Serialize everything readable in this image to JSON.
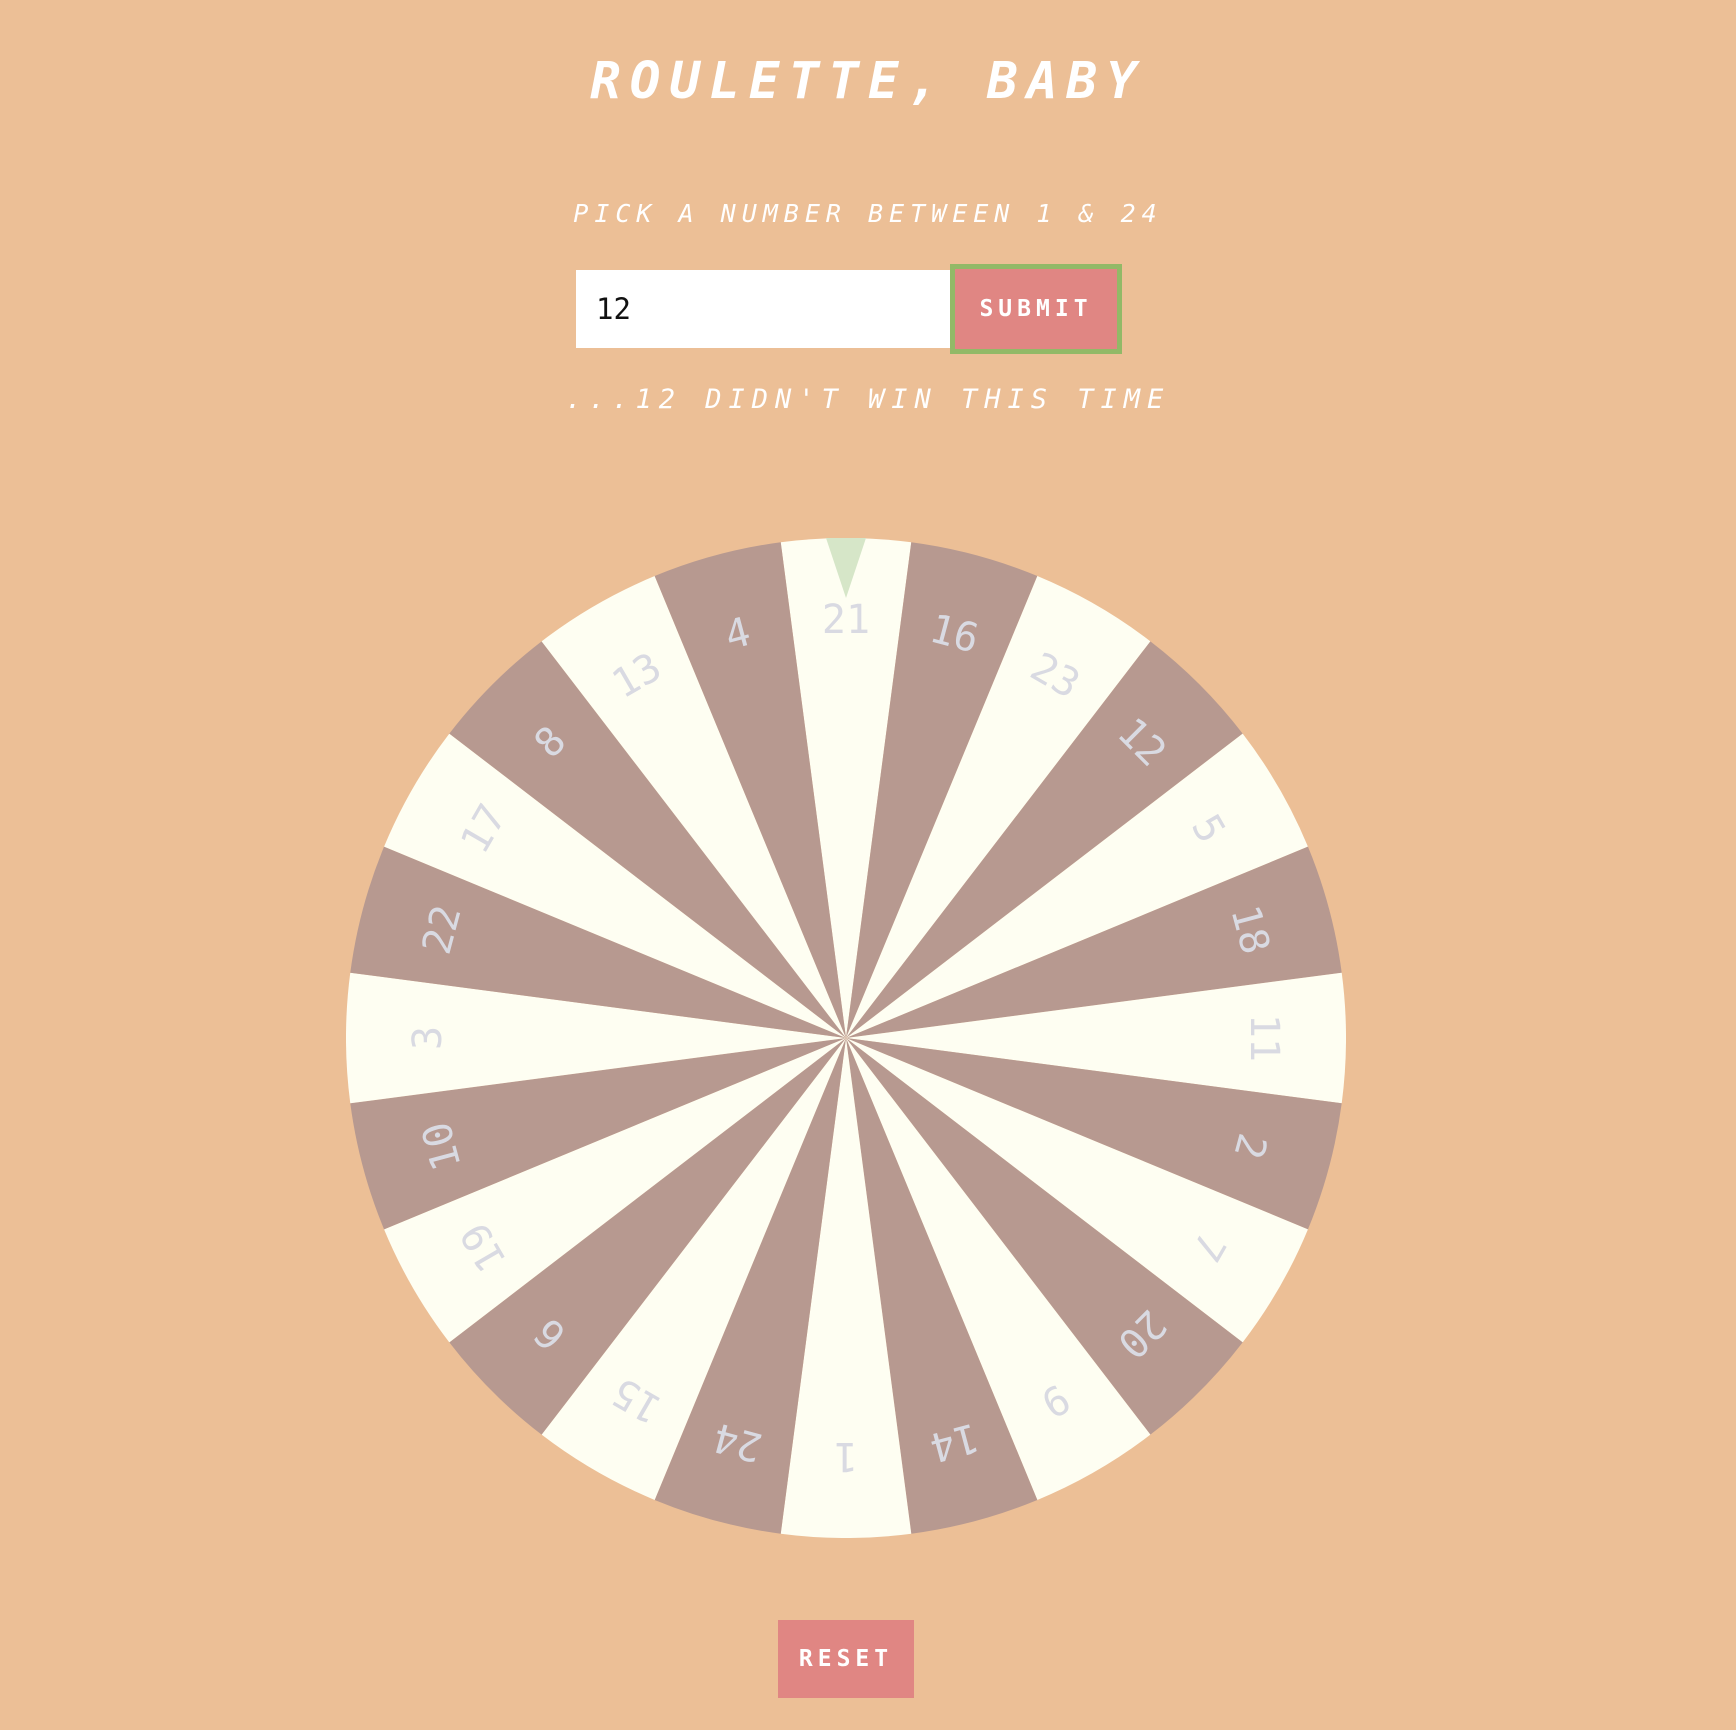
{
  "page": {
    "title": "ROULETTE, BABY",
    "prompt": "PICK A NUMBER BETWEEN 1 & 24",
    "result_message": "...12 DIDN'T WIN THIS TIME"
  },
  "form": {
    "input_value": "12",
    "submit_label": "SUBMIT"
  },
  "wheel": {
    "numbers": [
      21,
      16,
      23,
      12,
      5,
      18,
      11,
      2,
      7,
      20,
      9,
      14,
      1,
      24,
      15,
      6,
      19,
      10,
      3,
      22,
      17,
      8,
      13,
      4
    ],
    "segment_colors": [
      "#fefef2",
      "#b79990"
    ],
    "label_color": "#d9dae2",
    "pointer_color": "#d6e6c8"
  },
  "controls": {
    "reset_label": "RESET"
  },
  "colors": {
    "background": "#ecbf96",
    "button": "#e08683",
    "focus_ring": "#92b967"
  }
}
